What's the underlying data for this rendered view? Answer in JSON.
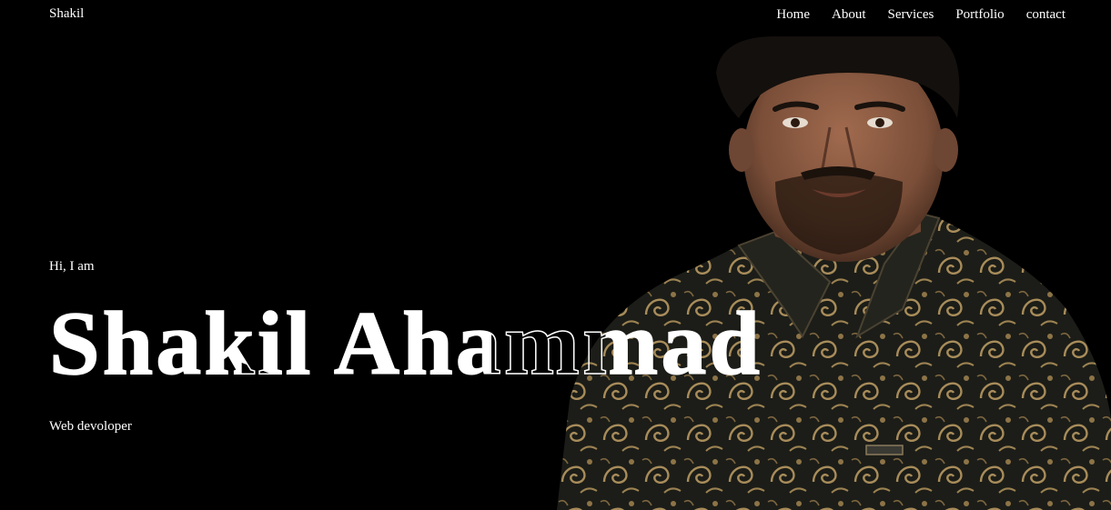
{
  "header": {
    "brand": "Shakil",
    "nav": [
      {
        "label": "Home"
      },
      {
        "label": "About"
      },
      {
        "label": "Services"
      },
      {
        "label": "Portfolio"
      },
      {
        "label": "contact"
      }
    ]
  },
  "hero": {
    "greeting": "Hi, I am",
    "name": "Shakil Ahammad",
    "role": "Web devoloper"
  },
  "colors": {
    "background": "#000000",
    "text": "#ffffff",
    "shirt_dark": "#1c1d18",
    "shirt_pattern": "#a88c5a",
    "skin": "#7a4e38"
  }
}
